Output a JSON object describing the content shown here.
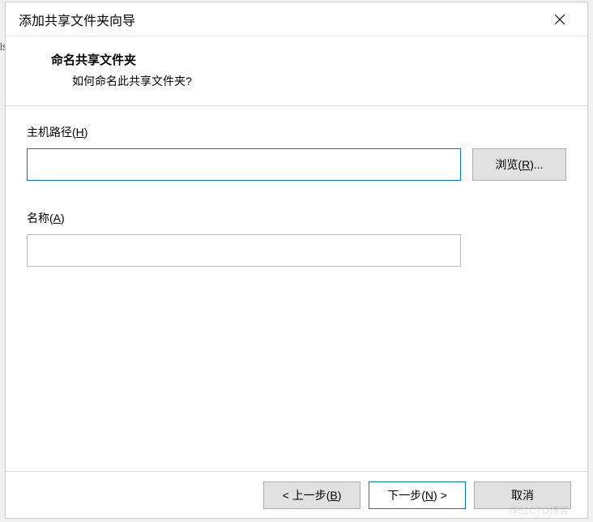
{
  "window": {
    "title": "添加共享文件夹向导"
  },
  "header": {
    "title": "命名共享文件夹",
    "subtitle": "如何命名此共享文件夹?"
  },
  "fields": {
    "hostPath": {
      "label_prefix": "主机路径(",
      "mnemonic": "H",
      "label_suffix": ")",
      "value": "",
      "browse_prefix": "浏览(",
      "browse_mnemonic": "R",
      "browse_suffix": ")..."
    },
    "name": {
      "label_prefix": "名称(",
      "mnemonic": "A",
      "label_suffix": ")",
      "value": ""
    }
  },
  "footer": {
    "back_prefix": "< 上一步(",
    "back_mnemonic": "B",
    "back_suffix": ")",
    "next_prefix": "下一步(",
    "next_mnemonic": "N",
    "next_suffix": ") >",
    "cancel": "取消"
  },
  "side_fragment": "ls",
  "watermark": "@51CTO博客"
}
